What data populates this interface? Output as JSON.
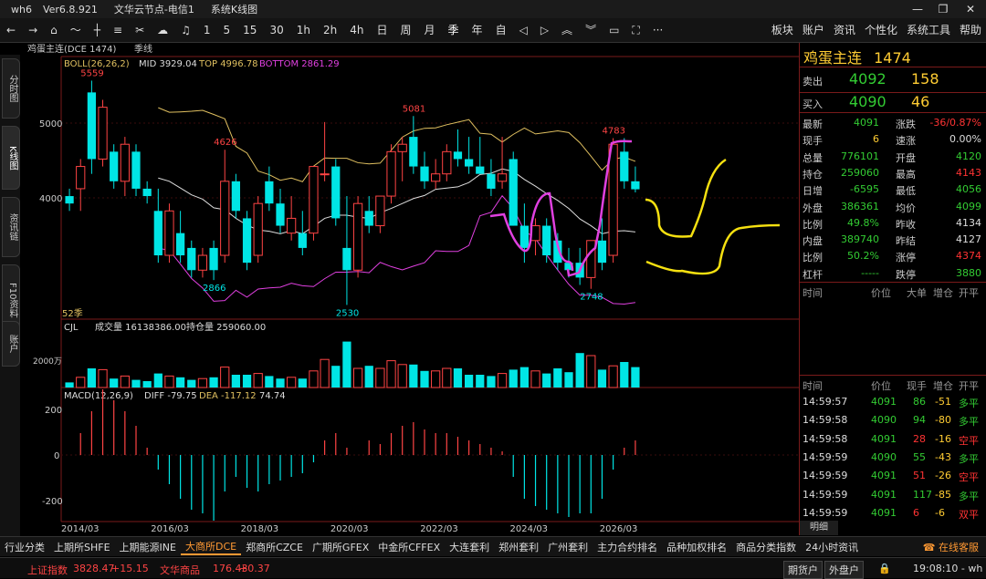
{
  "titlebar": {
    "app": "wh6",
    "version": "Ver6.8.921",
    "server": "文华云节点-电信1",
    "mode": "系统K线图"
  },
  "toolbar": {
    "periods": [
      "1",
      "5",
      "15",
      "30",
      "1h",
      "2h",
      "4h",
      "日",
      "周",
      "月",
      "季",
      "年",
      "自"
    ],
    "right_menu": [
      "板块",
      "账户",
      "资讯",
      "个性化",
      "系统工具",
      "帮助"
    ]
  },
  "sidetabs": [
    "分时图",
    "K线图",
    "资讯链",
    "F10资料",
    "账户"
  ],
  "chart": {
    "header_name": "鸡蛋主连(DCE 1474)",
    "period_label": "季线",
    "boll_label": "BOLL(26,26,2)",
    "mid": "MID 3929.04",
    "top": "TOP 4996.78",
    "bottom": "BOTTOM 2861.29",
    "y_labels": [
      "5000",
      "4000"
    ],
    "price_marks": [
      "5559",
      "4626",
      "5081",
      "4783",
      "2866",
      "2530",
      "2748"
    ],
    "count_label": "52季",
    "vol_label": "CJL",
    "vol_text": "成交量 16138386.00",
    "oi_text": "持仓量 259060.00",
    "vol_axis": "2000万",
    "macd_label": "MACD(12,26,9)",
    "diff": "DIFF -79.75",
    "dea": "DEA -117.12",
    "macd_val": "74.74",
    "macd_axis": [
      "200",
      "0",
      "-200"
    ],
    "x_labels": [
      "2014/03",
      "2016/03",
      "2018/03",
      "2020/03",
      "2022/03",
      "2024/03",
      "2026/03"
    ]
  },
  "chart_data": {
    "type": "candlestick",
    "title": "鸡蛋主连(DCE 1474)",
    "ylim": [
      2400,
      5700
    ],
    "candles": [
      {
        "o": 4000,
        "h": 4100,
        "l": 3800,
        "c": 3900
      },
      {
        "o": 4100,
        "h": 4500,
        "l": 3800,
        "c": 4400
      },
      {
        "o": 5400,
        "h": 5559,
        "l": 4300,
        "c": 4500
      },
      {
        "o": 4500,
        "h": 5300,
        "l": 4400,
        "c": 5200
      },
      {
        "o": 4600,
        "h": 4700,
        "l": 4100,
        "c": 4200
      },
      {
        "o": 4200,
        "h": 4800,
        "l": 4000,
        "c": 4700
      },
      {
        "o": 4600,
        "h": 4700,
        "l": 4000,
        "c": 4100
      },
      {
        "o": 4100,
        "h": 4200,
        "l": 3900,
        "c": 4000
      },
      {
        "o": 3800,
        "h": 4100,
        "l": 3100,
        "c": 3200
      },
      {
        "o": 3200,
        "h": 3900,
        "l": 3100,
        "c": 3800
      },
      {
        "o": 3500,
        "h": 3800,
        "l": 3100,
        "c": 3200
      },
      {
        "o": 3300,
        "h": 3400,
        "l": 2900,
        "c": 3000
      },
      {
        "o": 3000,
        "h": 3300,
        "l": 2900,
        "c": 3200
      },
      {
        "o": 3300,
        "h": 3400,
        "l": 2866,
        "c": 3000
      },
      {
        "o": 3200,
        "h": 4626,
        "l": 3100,
        "c": 4200
      },
      {
        "o": 4200,
        "h": 4300,
        "l": 3700,
        "c": 3800
      },
      {
        "o": 3700,
        "h": 3800,
        "l": 3000,
        "c": 3100
      },
      {
        "o": 3200,
        "h": 4000,
        "l": 3100,
        "c": 3900
      },
      {
        "o": 4200,
        "h": 4400,
        "l": 3800,
        "c": 3900
      },
      {
        "o": 3900,
        "h": 4100,
        "l": 3500,
        "c": 3600
      },
      {
        "o": 3500,
        "h": 4000,
        "l": 3400,
        "c": 3700
      },
      {
        "o": 3500,
        "h": 3800,
        "l": 3200,
        "c": 3300
      },
      {
        "o": 3500,
        "h": 4400,
        "l": 3400,
        "c": 4400
      },
      {
        "o": 4300,
        "h": 5000,
        "l": 4200,
        "c": 4300
      },
      {
        "o": 4400,
        "h": 4500,
        "l": 3600,
        "c": 3700
      },
      {
        "o": 3300,
        "h": 4000,
        "l": 2530,
        "c": 3000
      },
      {
        "o": 3000,
        "h": 4000,
        "l": 2900,
        "c": 3900
      },
      {
        "o": 3800,
        "h": 4000,
        "l": 3500,
        "c": 3600
      },
      {
        "o": 3600,
        "h": 4000,
        "l": 3500,
        "c": 4000
      },
      {
        "o": 4000,
        "h": 4700,
        "l": 3900,
        "c": 4600
      },
      {
        "o": 4600,
        "h": 4800,
        "l": 4200,
        "c": 4700
      },
      {
        "o": 4800,
        "h": 5081,
        "l": 4300,
        "c": 4400
      },
      {
        "o": 4400,
        "h": 4600,
        "l": 4100,
        "c": 4200
      },
      {
        "o": 4200,
        "h": 4500,
        "l": 4100,
        "c": 4300
      },
      {
        "o": 4300,
        "h": 4700,
        "l": 4200,
        "c": 4600
      },
      {
        "o": 4600,
        "h": 4900,
        "l": 4400,
        "c": 4500
      },
      {
        "o": 4500,
        "h": 4800,
        "l": 4300,
        "c": 4400
      },
      {
        "o": 4400,
        "h": 4800,
        "l": 4300,
        "c": 4300
      },
      {
        "o": 4300,
        "h": 4500,
        "l": 4000,
        "c": 4100
      },
      {
        "o": 4200,
        "h": 4800,
        "l": 4100,
        "c": 4300
      },
      {
        "o": 4500,
        "h": 4600,
        "l": 3600,
        "c": 3600
      },
      {
        "o": 3600,
        "h": 3900,
        "l": 3100,
        "c": 3300
      },
      {
        "o": 3400,
        "h": 3700,
        "l": 3200,
        "c": 3600
      },
      {
        "o": 3600,
        "h": 3700,
        "l": 3100,
        "c": 3200
      },
      {
        "o": 3400,
        "h": 3500,
        "l": 3000,
        "c": 3100
      },
      {
        "o": 3100,
        "h": 3300,
        "l": 2900,
        "c": 3000
      },
      {
        "o": 3100,
        "h": 3300,
        "l": 2800,
        "c": 2900
      },
      {
        "o": 2900,
        "h": 3400,
        "l": 2748,
        "c": 3400
      },
      {
        "o": 3400,
        "h": 3700,
        "l": 3000,
        "c": 3100
      },
      {
        "o": 3200,
        "h": 4783,
        "l": 3100,
        "c": 4700
      },
      {
        "o": 4600,
        "h": 4783,
        "l": 4100,
        "c": 4200
      },
      {
        "o": 4200,
        "h": 4400,
        "l": 4050,
        "c": 4092
      }
    ],
    "volume_max": 4000,
    "volumes": [
      400,
      800,
      1500,
      1400,
      700,
      900,
      600,
      500,
      1100,
      900,
      800,
      600,
      700,
      800,
      1600,
      1000,
      1000,
      1100,
      900,
      700,
      800,
      700,
      1300,
      2200,
      1700,
      3600,
      1500,
      1700,
      1500,
      2100,
      1800,
      1800,
      1300,
      1300,
      1500,
      1500,
      1000,
      1000,
      900,
      1100,
      1400,
      1600,
      1300,
      1100,
      1500,
      1200,
      2700,
      2500,
      1400,
      1700,
      2000,
      1600
    ],
    "macd_ylim": [
      -250,
      250
    ],
    "macd_hist": [
      0,
      60,
      120,
      180,
      150,
      120,
      80,
      20,
      -40,
      -80,
      -120,
      -150,
      -160,
      -180,
      -100,
      -60,
      -90,
      -100,
      -80,
      -70,
      -60,
      -50,
      -20,
      40,
      60,
      20,
      0,
      40,
      30,
      60,
      80,
      90,
      70,
      60,
      60,
      50,
      40,
      30,
      20,
      10,
      -60,
      -120,
      -140,
      -150,
      -160,
      -170,
      -160,
      -160,
      -120,
      -40,
      20,
      40
    ]
  },
  "quote": {
    "name": "鸡蛋主连",
    "code": "1474",
    "sell_label": "卖出",
    "sell_price": "4092",
    "sell_vol": "158",
    "buy_label": "买入",
    "buy_price": "4090",
    "buy_vol": "46",
    "fields": [
      {
        "l1": "最新",
        "v1": "4091",
        "l2": "涨跌",
        "v2": "-36/0.87%"
      },
      {
        "l1": "现手",
        "v1": "6",
        "l2": "速涨",
        "v2": "0.00%"
      },
      {
        "l1": "总量",
        "v1": "776101",
        "l2": "开盘",
        "v2": "4120"
      },
      {
        "l1": "持仓",
        "v1": "259060",
        "l2": "最高",
        "v2": "4143"
      },
      {
        "l1": "日增",
        "v1": "-6595",
        "l2": "最低",
        "v2": "4056"
      },
      {
        "l1": "外盘",
        "v1": "386361",
        "l2": "均价",
        "v2": "4099"
      },
      {
        "l1": "比例",
        "v1": "49.8%",
        "l2": "昨收",
        "v2": "4134"
      },
      {
        "l1": "内盘",
        "v1": "389740",
        "l2": "昨结",
        "v2": "4127"
      },
      {
        "l1": "比例",
        "v1": "50.2%",
        "l2": "涨停",
        "v2": "4374"
      },
      {
        "l1": "杠杆",
        "v1": "-----",
        "l2": "跌停",
        "v2": "3880"
      }
    ],
    "tick_header": [
      "时间",
      "价位",
      "大单",
      "增仓",
      "开平"
    ],
    "trade_header": [
      "时间",
      "价位",
      "现手",
      "增仓",
      "开平"
    ],
    "trades": [
      {
        "t": "14:59:57",
        "p": "4091",
        "v": "86",
        "d": "-51",
        "k": "多平"
      },
      {
        "t": "14:59:58",
        "p": "4090",
        "v": "94",
        "d": "-80",
        "k": "多平"
      },
      {
        "t": "14:59:58",
        "p": "4091",
        "v": "28",
        "d": "-16",
        "k": "空平"
      },
      {
        "t": "14:59:59",
        "p": "4090",
        "v": "55",
        "d": "-43",
        "k": "多平"
      },
      {
        "t": "14:59:59",
        "p": "4091",
        "v": "51",
        "d": "-26",
        "k": "空平"
      },
      {
        "t": "14:59:59",
        "p": "4091",
        "v": "117",
        "d": "-85",
        "k": "多平"
      },
      {
        "t": "14:59:59",
        "p": "4091",
        "v": "6",
        "d": "-6",
        "k": "双平"
      }
    ],
    "detail_tab": "明细"
  },
  "bottom_tabs": [
    "行业分类",
    "上期所SHFE",
    "上期能源INE",
    "大商所DCE",
    "郑商所CZCE",
    "广期所GFEX",
    "中金所CFFEX",
    "大连套利",
    "郑州套利",
    "广州套利",
    "主力合约排名",
    "品种加权排名",
    "商品分类指数",
    "24小时资讯"
  ],
  "bottom_right": "在线客服",
  "status": {
    "idx1_name": "上证指数",
    "idx1_val": "3828.47",
    "idx1_chg": "+15.15",
    "idx2_name": "文华商品",
    "idx2_val": "176.43",
    "idx2_chg": "+0.37",
    "acct1": "期货户",
    "acct2": "外盘户",
    "time": "19:08:10 - wh"
  }
}
